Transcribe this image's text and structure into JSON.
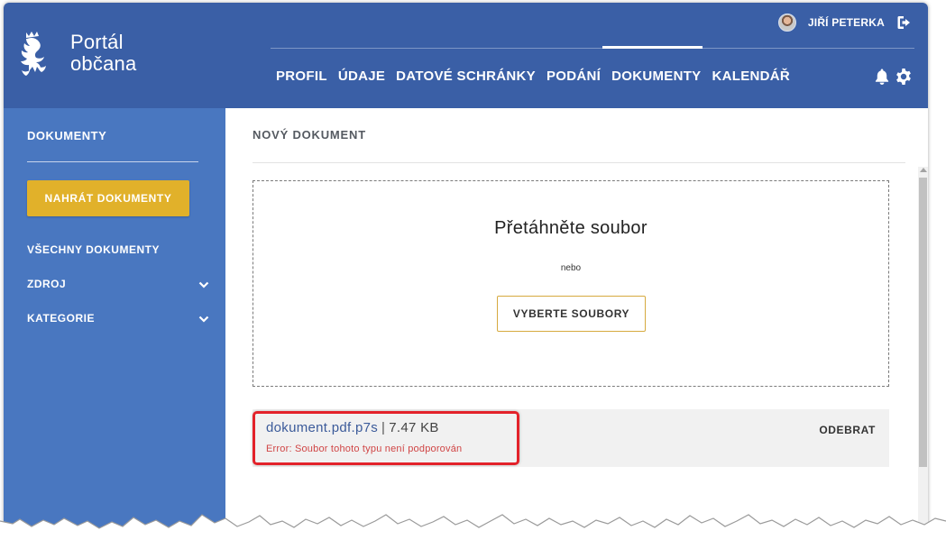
{
  "header": {
    "logo_line1": "Portál",
    "logo_line2": "občana",
    "user_name": "JIŘÍ PETERKA",
    "nav": [
      "PROFIL",
      "ÚDAJE",
      "DATOVÉ SCHRÁNKY",
      "PODÁNÍ",
      "DOKUMENTY",
      "KALENDÁŘ"
    ],
    "active_nav": "DOKUMENTY",
    "icons": [
      "avatar",
      "logout-icon",
      "bell-icon",
      "gear-icon",
      "lion-logo"
    ]
  },
  "sidebar": {
    "title": "DOKUMENTY",
    "upload_label": "NAHRÁT DOKUMENTY",
    "items": [
      {
        "label": "VŠECHNY DOKUMENTY",
        "expandable": false
      },
      {
        "label": "ZDROJ",
        "expandable": true
      },
      {
        "label": "KATEGORIE",
        "expandable": true
      }
    ]
  },
  "main": {
    "title": "NOVÝ DOKUMENT",
    "dropzone": {
      "title": "Přetáhněte soubor",
      "or": "nebo",
      "choose_label": "VYBERTE SOUBORY"
    },
    "file": {
      "name": "dokument.pdf.p7s",
      "separator": "|",
      "size": "7.47 KB",
      "error": "Error: Soubor tohoto typu není podporován",
      "remove_label": "ODEBRAT"
    }
  },
  "colors": {
    "header_bg": "#3a5fa6",
    "sidebar_bg": "#4977c0",
    "upload_button": "#e1b12a",
    "error_text": "#d04545",
    "highlight": "#e3222a"
  }
}
